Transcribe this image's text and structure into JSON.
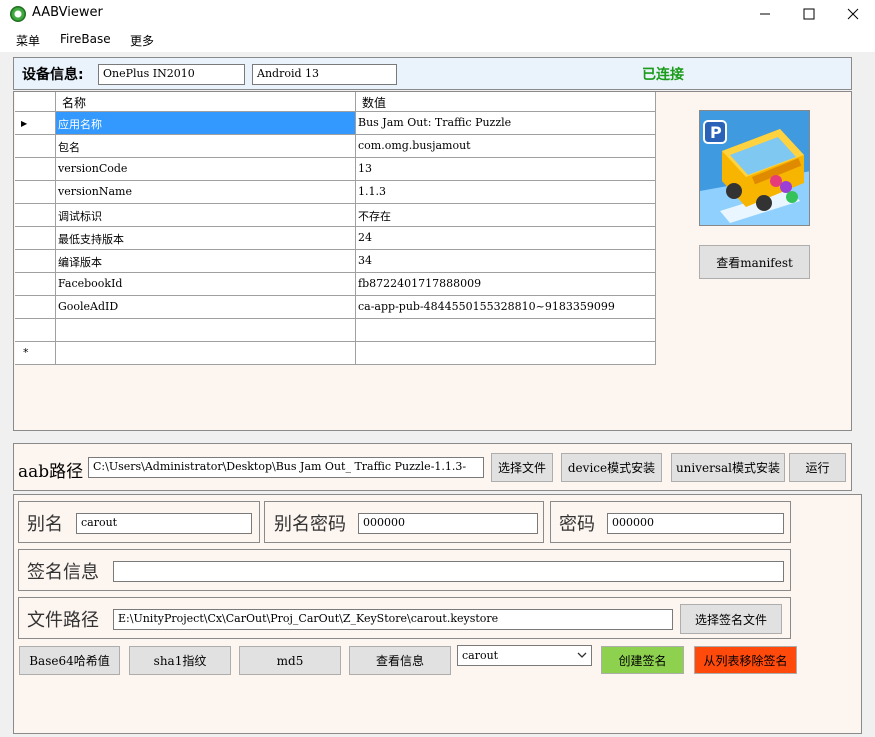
{
  "window": {
    "title": "AABViewer",
    "minimize": "─",
    "maximize": "☐",
    "close": "✕"
  },
  "menu": [
    "菜单",
    "FireBase",
    "更多"
  ],
  "device": {
    "label": "设备信息:",
    "model": "OnePlus IN2010",
    "android": "Android 13",
    "status": "已连接",
    "status_color": "#1a9c1a"
  },
  "grid": {
    "headers": [
      "名称",
      "数值"
    ],
    "row_marker": "▶",
    "new_row_marker": "*",
    "rows": [
      [
        "应用名称",
        "Bus Jam Out: Traffic Puzzle"
      ],
      [
        "包名",
        "com.omg.busjamout"
      ],
      [
        "versionCode",
        "13"
      ],
      [
        "versionName",
        "1.1.3"
      ],
      [
        "调试标识",
        "不存在"
      ],
      [
        "最低支持版本",
        "24"
      ],
      [
        "编译版本",
        "34"
      ],
      [
        "FacebookId",
        "fb8722401717888009"
      ],
      [
        "GooleAdID",
        "ca-app-pub-4844550155328810~9183359099"
      ],
      [
        "",
        ""
      ]
    ]
  },
  "manifest_button": "查看manifest",
  "aab": {
    "label": "aab路径",
    "path": "C:\\Users\\Administrator\\Desktop\\Bus Jam Out_ Traffic Puzzle-1.1.3-",
    "choose_file": "选择文件",
    "device_install": "device模式安装",
    "universal_install": "universal模式安装",
    "run": "运行"
  },
  "sign": {
    "alias_label": "别名",
    "alias_value": "carout",
    "alias_pwd_label": "别名密码",
    "alias_pwd_value": "000000",
    "pwd_label": "密码",
    "pwd_value": "000000",
    "sign_info_label": "签名信息",
    "sign_info_value": "",
    "file_label": "文件路径",
    "file_value": "E:\\UnityProject\\Cx\\CarOut\\Proj_CarOut\\Z_KeyStore\\carout.keystore",
    "choose_sign_file": "选择签名文件",
    "base64": "Base64哈希值",
    "sha1": "sha1指纹",
    "md5": "md5",
    "view_info": "查看信息",
    "selected_alias": "carout",
    "create": "创建签名",
    "remove": "从列表移除签名",
    "create_color": "#8dd14f",
    "remove_color": "#ff4a0c"
  }
}
